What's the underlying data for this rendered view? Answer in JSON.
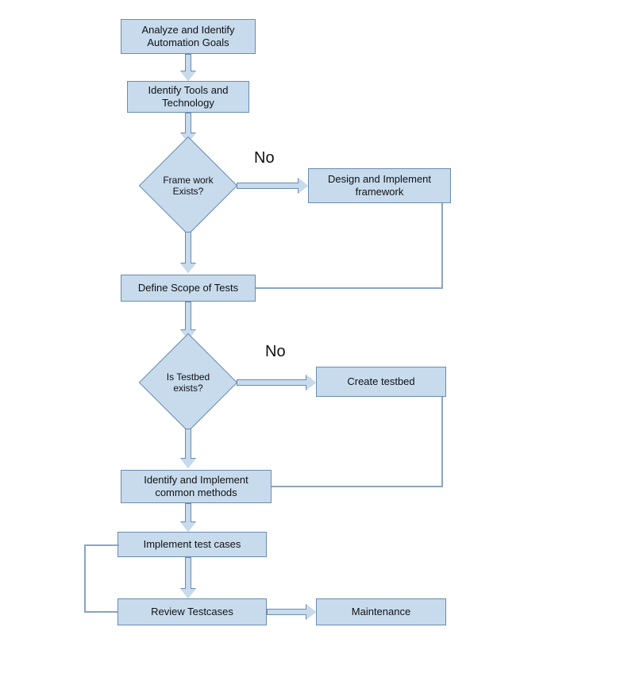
{
  "chart_data": {
    "type": "flowchart",
    "nodes": [
      {
        "id": "n1",
        "kind": "process",
        "label": "Analyze and Identify Automation Goals"
      },
      {
        "id": "n2",
        "kind": "process",
        "label": "Identify Tools and Technology"
      },
      {
        "id": "d1",
        "kind": "decision",
        "label": "Frame work Exists?"
      },
      {
        "id": "n3",
        "kind": "process",
        "label": "Design and Implement framework"
      },
      {
        "id": "n4",
        "kind": "process",
        "label": "Define Scope of Tests"
      },
      {
        "id": "d2",
        "kind": "decision",
        "label": "Is Testbed exists?"
      },
      {
        "id": "n5",
        "kind": "process",
        "label": "Create testbed"
      },
      {
        "id": "n6",
        "kind": "process",
        "label": "Identify and Implement common methods"
      },
      {
        "id": "n7",
        "kind": "process",
        "label": "Implement test cases"
      },
      {
        "id": "n8",
        "kind": "process",
        "label": "Review Testcases"
      },
      {
        "id": "n9",
        "kind": "process",
        "label": "Maintenance"
      }
    ],
    "edges": [
      {
        "from": "n1",
        "to": "n2"
      },
      {
        "from": "n2",
        "to": "d1"
      },
      {
        "from": "d1",
        "to": "n3",
        "label": "No"
      },
      {
        "from": "d1",
        "to": "n4"
      },
      {
        "from": "n3",
        "to": "n4"
      },
      {
        "from": "n4",
        "to": "d2"
      },
      {
        "from": "d2",
        "to": "n5",
        "label": "No"
      },
      {
        "from": "d2",
        "to": "n6"
      },
      {
        "from": "n5",
        "to": "n6"
      },
      {
        "from": "n6",
        "to": "n7"
      },
      {
        "from": "n7",
        "to": "n8"
      },
      {
        "from": "n8",
        "to": "n7"
      },
      {
        "from": "n8",
        "to": "n9"
      }
    ]
  },
  "labels": {
    "no1": "No",
    "no2": "No"
  }
}
